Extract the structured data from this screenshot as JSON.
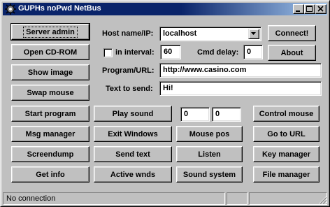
{
  "window": {
    "title": "GUPHs noPwd NetBus"
  },
  "titlebar_buttons": [
    "minimize",
    "maximize",
    "close"
  ],
  "left_buttons": {
    "server_admin": "Server admin",
    "open_cdrom": "Open CD-ROM",
    "show_image": "Show image",
    "swap_mouse": "Swap mouse"
  },
  "connection": {
    "host_label": "Host name/IP:",
    "host_value": "localhost",
    "connect_label": "Connect!",
    "interval_label": "in interval:",
    "interval_checked": false,
    "interval_value": "60",
    "cmd_delay_label": "Cmd delay:",
    "cmd_delay_value": "0",
    "about_label": "About"
  },
  "program": {
    "label": "Program/URL:",
    "value": "http://www.casino.com"
  },
  "text_to_send": {
    "label": "Text to send:",
    "value": "Hi!"
  },
  "grid_buttons": {
    "row1": [
      "Start program",
      "Play sound",
      "",
      "Control mouse"
    ],
    "row2": [
      "Msg manager",
      "Exit Windows",
      "Mouse pos",
      "Go to URL"
    ],
    "row3": [
      "Screendump",
      "Send text",
      "Listen",
      "Key manager"
    ],
    "row4": [
      "Get info",
      "Active wnds",
      "Sound system",
      "File manager"
    ]
  },
  "mouse_fields": {
    "x_value": "0",
    "y_value": "0"
  },
  "statusbar": {
    "text": "No connection",
    "panel2": "",
    "panel3": ""
  },
  "colors": {
    "titlebar_start": "#0a246a",
    "titlebar_end": "#a6caf0",
    "face": "#c0c0c0"
  },
  "icons": {
    "app": "netbus-gear-icon",
    "combo": "chevron-down-icon",
    "resize": "size-grip-icon"
  }
}
